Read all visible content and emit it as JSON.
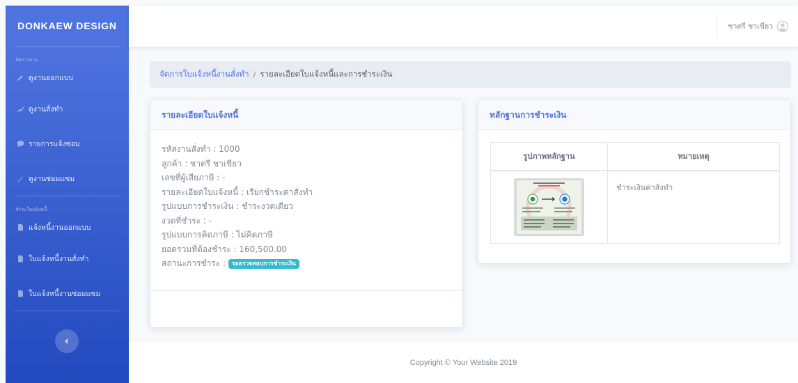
{
  "brand": "DONKAEW DESIGN",
  "sidebar": {
    "heading_1": "จัดการงาน",
    "heading_2": "ชำระใบแจ้งหนี้",
    "items": [
      {
        "label": "ดูงานออกแบบ",
        "icon": "pencil-icon"
      },
      {
        "label": "ดูงานสั่งทำ",
        "icon": "chart-line-icon"
      },
      {
        "label": "รายการแจ้งซ่อม",
        "icon": "comment-icon"
      },
      {
        "label": "ดูงานซ่อมแซม",
        "icon": "pen-icon"
      },
      {
        "label": "แจ้งหนี้งานออกแบบ",
        "icon": "file-icon"
      },
      {
        "label": "ใบแจ้งหนี้งานสั่งทำ",
        "icon": "file-icon"
      },
      {
        "label": "ใบแจ้งหนี้งานซ่อมแซม",
        "icon": "file-icon"
      }
    ]
  },
  "topbar": {
    "user_name": "ชาตรี ชาเขียว"
  },
  "breadcrumb": {
    "parent": "จัดการใบแจ้งหนี้งานสั่งทำ",
    "separator": "/",
    "current": "รายละเอียดใบแจ้งหนี้และการชำระเงิน"
  },
  "invoice_card": {
    "title": "รายละเอียดใบแจ้งหนี้",
    "lines": [
      "รหัสงานสั่งทำ : 1000",
      "ลูกค้า : ชาตรี ชาเขียว",
      "เลขที่ผู้เสียภาษี : -",
      "รายละเอียดใบแจ้งหนี้ : เรียกชำระค่าสั่งทำ",
      "รูปแบบการชำระเงิน : ชำระงวดเดียว",
      "งวดที่ชำระ : -",
      "รูปแบบการคิดภาษี : ไม่คิดภาษี",
      "ยอดรวมที่ต้องชำระ : 160,500.00"
    ],
    "status_label": "สถานะการชำระ :",
    "status_badge": "รอตรวจสอบการชำระเงิน",
    "status_color": "#36b9cc"
  },
  "payment_card": {
    "title": "หลักฐานการชำระเงิน",
    "columns": [
      "รูปภาพหลักฐาน",
      "หมายเหตุ"
    ],
    "rows": [
      {
        "note": "ชำระเงินค่าสั่งทำ"
      }
    ]
  },
  "footer": {
    "copyright": "Copyright © Your Website 2019"
  },
  "colors": {
    "primary": "#4e73df",
    "sidebar_gradient_end": "#224abe",
    "badge_info": "#36b9cc"
  }
}
